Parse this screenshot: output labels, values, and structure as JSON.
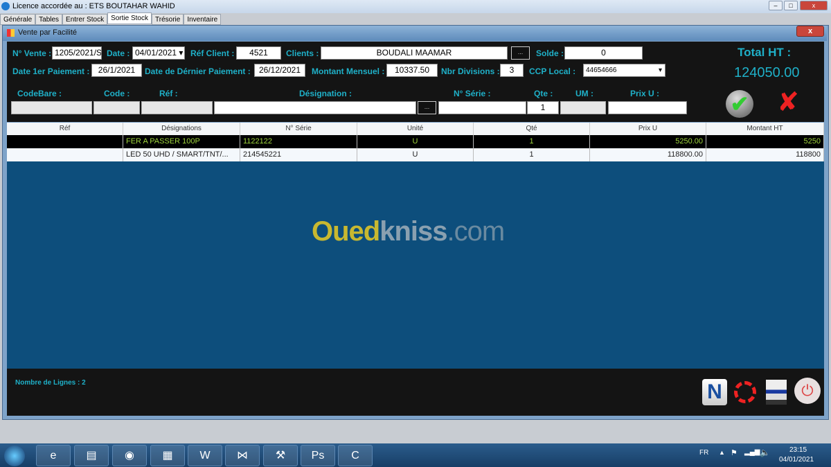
{
  "app": {
    "title": "Licence accordée au : ETS BOUTAHAR WAHID",
    "tabs": [
      "Générale",
      "Tables",
      "Entrer Stock",
      "Sortie Stock",
      "Trésorie",
      "Inventaire"
    ],
    "active_tab": "Sortie Stock"
  },
  "window": {
    "title": "Vente par Facilité",
    "close": "x"
  },
  "form": {
    "n_vente_label": "N° Vente :",
    "n_vente": "1205/2021/S",
    "date_label": "Date :",
    "date": "04/01/2021",
    "ref_client_label": "Réf Client :",
    "ref_client": "4521",
    "clients_label": "Clients :",
    "client": "BOUDALI  MAAMAR",
    "browse": "...",
    "solde_label": "Solde :",
    "solde": "0",
    "date1_label": "Date 1er Paiement :",
    "date1": "26/1/2021",
    "datelast_label": "Date de Dérnier Paiement :",
    "datelast": "26/12/2021",
    "montant_label": "Montant Mensuel :",
    "montant": "10337.50",
    "nbr_label": "Nbr Divisions :",
    "nbr": "3",
    "ccp_label": "CCP  Local :",
    "ccp": "44654666",
    "total_label": "Total HT :",
    "total": "124050.00"
  },
  "entry": {
    "codebare": "CodeBare :",
    "code": "Code :",
    "ref": "Réf :",
    "designation": "Désignation :",
    "serie": "N° Série :",
    "qte": "Qte :",
    "um": "UM :",
    "prix": "Prix U :",
    "qte_value": "1",
    "browse": "..."
  },
  "grid": {
    "columns": [
      "Réf",
      "Désignations",
      "N° Série",
      "Unité",
      "Qté",
      "Prix U",
      "Montant HT"
    ],
    "rows": [
      [
        "",
        "FER A PASSER  100P",
        "1122122",
        "U",
        "1",
        "5250.00",
        "5250"
      ],
      [
        "",
        "LED 50 UHD / SMART/TNT/...",
        "214545221",
        "U",
        "1",
        "118800.00",
        "118800"
      ]
    ]
  },
  "watermark": {
    "a": "Oued",
    "b": "kniss",
    "c": ".com"
  },
  "footer": {
    "lines": "Nombre de Lignes : 2",
    "new": "N"
  },
  "taskbar": {
    "lang": "FR",
    "time": "23:15",
    "date": "04/01/2021"
  },
  "colors": {
    "label": "#1fb0c8",
    "grid_bg": "#0d4e7c",
    "selected_row_text": "#9ed43c"
  }
}
